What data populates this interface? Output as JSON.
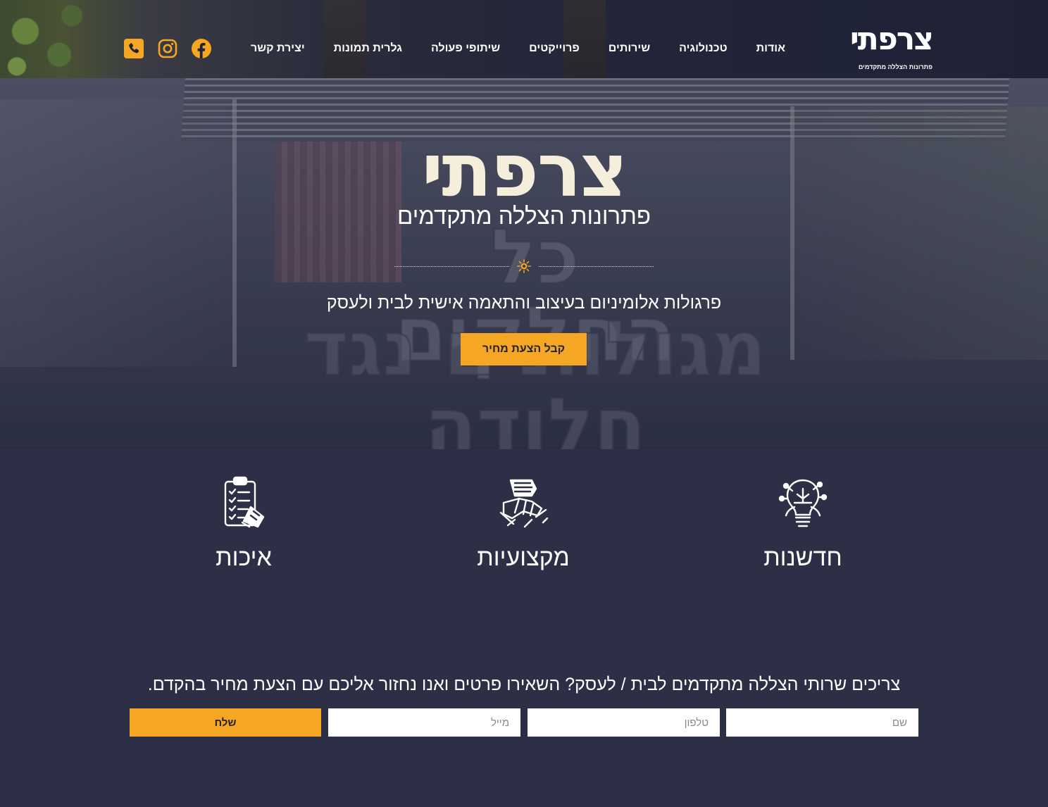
{
  "brand": {
    "logo_text": "צרפתי",
    "logo_tagline": "פתרונות הצללה מתקדמים"
  },
  "nav": {
    "items": [
      {
        "label": "אודות"
      },
      {
        "label": "טכנולוגיה"
      },
      {
        "label": "שירותים"
      },
      {
        "label": "פרוייקטים"
      },
      {
        "label": "שיתופי פעולה"
      },
      {
        "label": "גלרית תמונות"
      },
      {
        "label": "יצירת קשר"
      }
    ]
  },
  "social": {
    "icons": [
      "facebook-icon",
      "instagram-icon",
      "phone-icon"
    ],
    "color": "#f5a623"
  },
  "hero": {
    "title": "צרפתי",
    "subtitle": "פתרונות הצללה מתקדמים",
    "description": "פרגולות אלומיניום בעיצוב והתאמה אישית לבית ולעסק",
    "cta_label": "קבל הצעת מחיר",
    "background_text_1": "כל החלקים",
    "background_text_2": "מגולוונים נגד חלודה"
  },
  "features": [
    {
      "label": "חדשנות",
      "icon": "lightbulb-icon"
    },
    {
      "label": "מקצועיות",
      "icon": "handshake-icon"
    },
    {
      "label": "איכות",
      "icon": "checklist-icon"
    }
  ],
  "contact": {
    "heading": "צריכים שרותי הצללה מתקדמים לבית / לעסק? השאירו פרטים ואנו נחזור אליכם עם הצעת מחיר בהקדם.",
    "name_placeholder": "שם",
    "phone_placeholder": "טלפון",
    "email_placeholder": "מייל",
    "submit_label": "שלח"
  },
  "colors": {
    "accent": "#f5a623",
    "background": "#2c2f45",
    "header": "#1f2236",
    "title": "#f4eedb"
  }
}
